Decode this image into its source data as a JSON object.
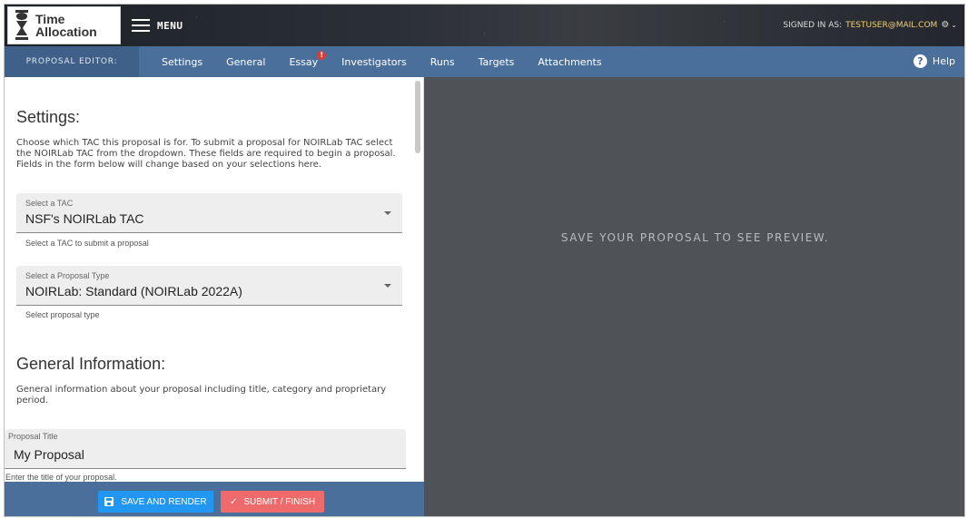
{
  "header": {
    "logo_line1": "Time",
    "logo_line2": "Allocation",
    "menu_label": "MENU",
    "signed_in_prefix": "SIGNED IN AS:",
    "user_email": "TESTUSER@MAIL.COM",
    "icons": {
      "menu": "hamburger-icon",
      "settings": "gear-icon",
      "caret": "chevron-down-icon"
    }
  },
  "nav": {
    "editor_label": "PROPOSAL EDITOR:",
    "tabs": [
      {
        "label": "Settings"
      },
      {
        "label": "General"
      },
      {
        "label": "Essay",
        "badge": "!"
      },
      {
        "label": "Investigators"
      },
      {
        "label": "Runs"
      },
      {
        "label": "Targets"
      },
      {
        "label": "Attachments"
      }
    ],
    "help_label": "Help"
  },
  "settings": {
    "heading": "Settings:",
    "description": "Choose which TAC this proposal is for. To submit a proposal for NOIRLab TAC select the NOIRLab TAC from the dropdown. These fields are required to begin a proposal. Fields in the form below will change based on your selections here.",
    "tac": {
      "label": "Select a TAC",
      "value": "NSF's NOIRLab TAC",
      "hint": "Select a TAC to submit a proposal"
    },
    "proposal_type": {
      "label": "Select a Proposal Type",
      "value": "NOIRLab: Standard (NOIRLab 2022A)",
      "hint": "Select proposal type"
    }
  },
  "general": {
    "heading": "General Information:",
    "description": "General information about your proposal including title, category and proprietary period.",
    "title_field": {
      "label": "Proposal Title",
      "value": "My Proposal",
      "hint": "Enter the title of your proposal."
    }
  },
  "actions": {
    "save_label": "SAVE AND RENDER",
    "submit_label": "SUBMIT / FINISH"
  },
  "preview": {
    "message": "SAVE YOUR PROPOSAL TO SEE PREVIEW."
  },
  "colors": {
    "navbar": "#4a6f9b",
    "save_button": "#2196f3",
    "submit_button": "#ef6b6b",
    "preview_bg": "#4f5257",
    "user_email": "#f0d070"
  }
}
